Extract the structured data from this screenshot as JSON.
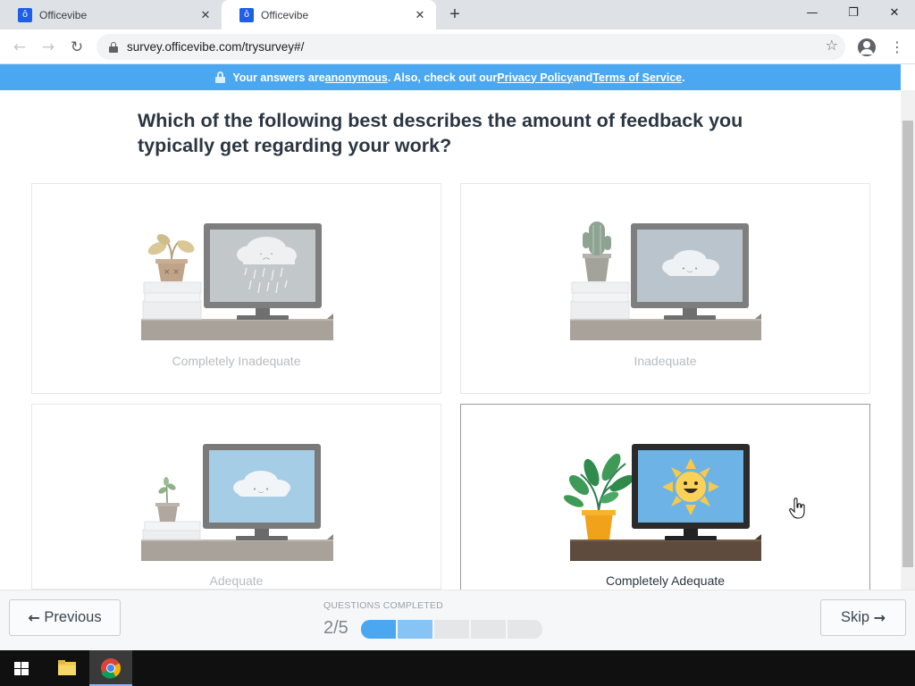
{
  "browser": {
    "tabs": [
      {
        "title": "Officevibe",
        "favicon": "ô"
      },
      {
        "title": "Officevibe",
        "favicon": "ô"
      }
    ],
    "tab_close_glyph": "✕",
    "new_tab_glyph": "+",
    "url": "survey.officevibe.com/trysurvey#/",
    "window_controls": {
      "minimize": "—",
      "restore": "❐",
      "close": "✕"
    }
  },
  "banner": {
    "prefix": "Your answers are ",
    "anonymous": "anonymous",
    "middle": ". Also, check out our ",
    "privacy": "Privacy Policy",
    "and": " and ",
    "terms": "Terms of Service",
    "suffix": "."
  },
  "question": "Which of the following best describes the amount of feedback you typically get regarding your work?",
  "options": [
    {
      "label": "Completely Inadequate"
    },
    {
      "label": "Inadequate"
    },
    {
      "label": "Adequate"
    },
    {
      "label": "Completely Adequate",
      "selected": true
    }
  ],
  "footer": {
    "previous_label": "Previous",
    "skip_label": "Skip",
    "progress_label": "QUESTIONS COMPLETED",
    "progress_count": "2/5",
    "progress": {
      "completed": 2,
      "total": 5
    }
  },
  "colors": {
    "accent": "#4aa7f0",
    "text": "#2b3642"
  }
}
